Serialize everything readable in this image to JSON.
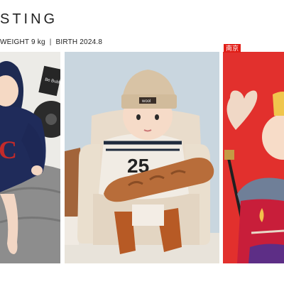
{
  "header": {
    "brand_text": "STING",
    "weight_label": "WEIGHT",
    "weight_value": "9 kg",
    "separator": "|",
    "birth_label": "BIRTH",
    "birth_value": "2024.8"
  },
  "photos": [
    {
      "badge": "",
      "alt_sign_text": "Be Bubble",
      "jersey_letter": "C"
    },
    {
      "badge": "",
      "hat_tag": "wool",
      "jersey_number": "25"
    },
    {
      "badge": "南京"
    }
  ],
  "colors": {
    "badge_red": "#e11d16",
    "panel3_bg": "#e2302d",
    "panel2_bg": "#c9d6df"
  }
}
